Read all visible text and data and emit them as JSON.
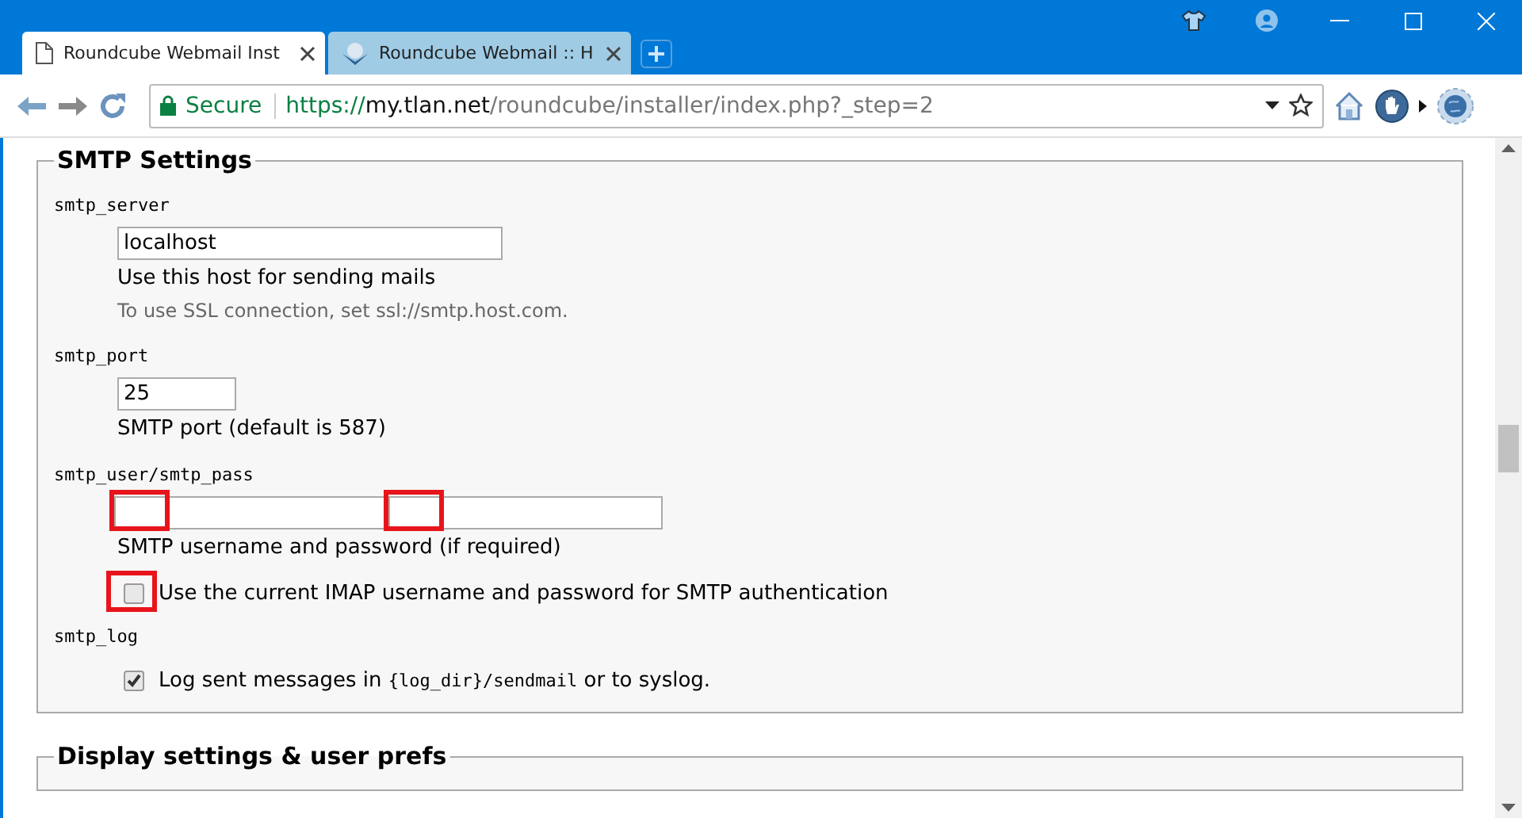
{
  "tabs": [
    {
      "title": "Roundcube Webmail Inst",
      "selected": true,
      "kind": "page"
    },
    {
      "title": "Roundcube Webmail :: H",
      "selected": false,
      "kind": "app"
    }
  ],
  "toolbar": {
    "security_label": "Secure",
    "url": {
      "scheme": "https://",
      "host": "my.tlan.net",
      "path": "/roundcube/installer/index.php?_step=2"
    }
  },
  "sections": [
    {
      "legend": "SMTP Settings",
      "items": [
        {
          "kind": "label",
          "text": "smtp_server"
        },
        {
          "kind": "fields",
          "fields": [
            {
              "value": "localhost",
              "kind": "wide",
              "highlighted": false
            }
          ]
        },
        {
          "kind": "text",
          "text": "Use this host for sending mails"
        },
        {
          "kind": "note",
          "text": "To use SSL connection, set ssl://smtp.host.com."
        },
        {
          "kind": "label",
          "text": "smtp_port"
        },
        {
          "kind": "fields",
          "fields": [
            {
              "value": "25",
              "kind": "short",
              "highlighted": false
            }
          ]
        },
        {
          "kind": "text",
          "text": "SMTP port (default is 587)"
        },
        {
          "kind": "label",
          "text": "smtp_user/smtp_pass"
        },
        {
          "kind": "fields",
          "fields": [
            {
              "kind": "medium",
              "highlighted": true
            },
            {
              "kind": "medium",
              "highlighted": true
            }
          ]
        },
        {
          "kind": "text",
          "text": "SMTP username and password (if required)"
        },
        {
          "kind": "checkbox",
          "checked": false,
          "highlighted": true,
          "parts": [
            {
              "text": "Use the current IMAP username and password for SMTP authentication",
              "mono": false
            }
          ]
        },
        {
          "kind": "label",
          "text": "smtp_log"
        },
        {
          "kind": "checkbox",
          "checked": true,
          "highlighted": false,
          "parts": [
            {
              "text": "Log sent messages in ",
              "mono": false
            },
            {
              "text": "{log_dir}/sendmail",
              "mono": true
            },
            {
              "text": " or to syslog.",
              "mono": false
            }
          ]
        }
      ]
    },
    {
      "legend": "Display settings & user prefs"
    }
  ]
}
